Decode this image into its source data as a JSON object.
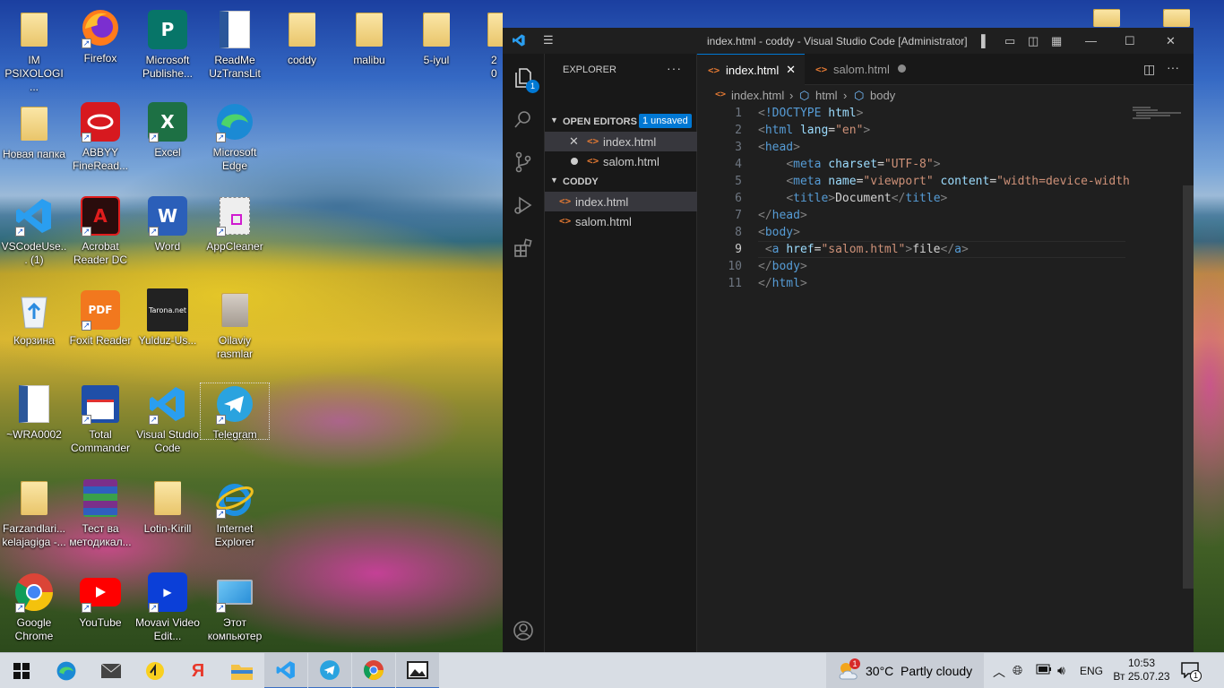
{
  "desktop": {
    "icons": {
      "im_psixologi": "IM PSIXOLOGI ...",
      "firefox": "Firefox",
      "publisher": "Microsoft Publishe...",
      "readme": "ReadMe UzTransLit",
      "coddy": "coddy",
      "malibu": "malibu",
      "iyul": "5-iyul",
      "partial20": "20",
      "novaya_papka": "Новая папка",
      "abbyy": "ABBYY FineRead...",
      "excel": "Excel",
      "edge": "Microsoft Edge",
      "vscode_user": "VSCodeUse... (1)",
      "acrobat": "Acrobat Reader DC",
      "word": "Word",
      "appcleaner": "AppCleaner",
      "korzina": "Корзина",
      "foxit": "Foxit Reader",
      "yulduz": "Yulduz-Us...",
      "oilaviy": "Oilaviy rasmlar",
      "wra": "~WRA0002",
      "total_commander": "Total Commander",
      "vscode": "Visual Studio Code",
      "telegram": "Telegram",
      "farzandlari": "Farzandlari... kelajagiga -...",
      "test": "Тест ва методикал...",
      "lotin": "Lotin-Kirill",
      "ie": "Internet Explorer",
      "chrome": "Google Chrome",
      "youtube": "YouTube",
      "movavi": "Movavi Video Edit...",
      "this_pc": "Этот компьютер",
      "tarona_tile": "Tarona.net"
    }
  },
  "vscode": {
    "window_title": "index.html - coddy - Visual Studio Code [Administrator]",
    "explorer_badge": "1",
    "sidebar": {
      "header": "EXPLORER",
      "more": "···",
      "open_editors": "OPEN EDITORS",
      "unsaved_badge": "1 unsaved",
      "open_files": [
        "index.html",
        "salom.html"
      ],
      "folder": "CODDY",
      "folder_files": [
        "index.html",
        "salom.html"
      ]
    },
    "tabs": [
      "index.html",
      "salom.html"
    ],
    "breadcrumb": [
      "index.html",
      "html",
      "body"
    ],
    "code": {
      "line_numbers": [
        "1",
        "2",
        "3",
        "4",
        "5",
        "6",
        "7",
        "8",
        "9",
        "10",
        "11"
      ],
      "current_line": 9,
      "lines": [
        [
          {
            "c": "p",
            "t": "<"
          },
          {
            "c": "t",
            "t": "!DOCTYPE"
          },
          {
            "c": "x",
            "t": " "
          },
          {
            "c": "a",
            "t": "html"
          },
          {
            "c": "p",
            "t": ">"
          }
        ],
        [
          {
            "c": "p",
            "t": "<"
          },
          {
            "c": "t",
            "t": "html"
          },
          {
            "c": "x",
            "t": " "
          },
          {
            "c": "a",
            "t": "lang"
          },
          {
            "c": "x",
            "t": "="
          },
          {
            "c": "s",
            "t": "\"en\""
          },
          {
            "c": "p",
            "t": ">"
          }
        ],
        [
          {
            "c": "p",
            "t": "<"
          },
          {
            "c": "t",
            "t": "head"
          },
          {
            "c": "p",
            "t": ">"
          }
        ],
        [
          {
            "c": "x",
            "t": "    "
          },
          {
            "c": "p",
            "t": "<"
          },
          {
            "c": "t",
            "t": "meta"
          },
          {
            "c": "x",
            "t": " "
          },
          {
            "c": "a",
            "t": "charset"
          },
          {
            "c": "x",
            "t": "="
          },
          {
            "c": "s",
            "t": "\"UTF-8\""
          },
          {
            "c": "p",
            "t": ">"
          }
        ],
        [
          {
            "c": "x",
            "t": "    "
          },
          {
            "c": "p",
            "t": "<"
          },
          {
            "c": "t",
            "t": "meta"
          },
          {
            "c": "x",
            "t": " "
          },
          {
            "c": "a",
            "t": "name"
          },
          {
            "c": "x",
            "t": "="
          },
          {
            "c": "s",
            "t": "\"viewport\""
          },
          {
            "c": "x",
            "t": " "
          },
          {
            "c": "a",
            "t": "content"
          },
          {
            "c": "x",
            "t": "="
          },
          {
            "c": "s",
            "t": "\"width=device-width"
          }
        ],
        [
          {
            "c": "x",
            "t": "    "
          },
          {
            "c": "p",
            "t": "<"
          },
          {
            "c": "t",
            "t": "title"
          },
          {
            "c": "p",
            "t": ">"
          },
          {
            "c": "x",
            "t": "Document"
          },
          {
            "c": "p",
            "t": "</"
          },
          {
            "c": "t",
            "t": "title"
          },
          {
            "c": "p",
            "t": ">"
          }
        ],
        [
          {
            "c": "p",
            "t": "</"
          },
          {
            "c": "t",
            "t": "head"
          },
          {
            "c": "p",
            "t": ">"
          }
        ],
        [
          {
            "c": "p",
            "t": "<"
          },
          {
            "c": "t",
            "t": "body"
          },
          {
            "c": "p",
            "t": ">"
          }
        ],
        [
          {
            "c": "x",
            "t": " "
          },
          {
            "c": "p",
            "t": "<"
          },
          {
            "c": "t",
            "t": "a"
          },
          {
            "c": "x",
            "t": " "
          },
          {
            "c": "a",
            "t": "href"
          },
          {
            "c": "x",
            "t": "="
          },
          {
            "c": "s",
            "t": "\"salom.html\""
          },
          {
            "c": "p",
            "t": ">"
          },
          {
            "c": "x",
            "t": "file"
          },
          {
            "c": "p",
            "t": "</"
          },
          {
            "c": "t",
            "t": "a"
          },
          {
            "c": "p",
            "t": ">"
          }
        ],
        [
          {
            "c": "p",
            "t": "</"
          },
          {
            "c": "t",
            "t": "body"
          },
          {
            "c": "p",
            "t": ">"
          }
        ],
        [
          {
            "c": "p",
            "t": "</"
          },
          {
            "c": "t",
            "t": "html"
          },
          {
            "c": "p",
            "t": ">"
          }
        ]
      ]
    },
    "colors": {
      "accent": "#0078d4",
      "tag": "#569cd6",
      "attr": "#9cdcfe",
      "string": "#ce9178",
      "html_icon": "#e37933"
    }
  },
  "taskbar": {
    "weather_temp": "30°C",
    "weather_cond": "Partly cloudy",
    "weather_badge": "1",
    "lang": "ENG",
    "time": "10:53",
    "date": "Вт 25.07.23",
    "notification_count": "1"
  }
}
